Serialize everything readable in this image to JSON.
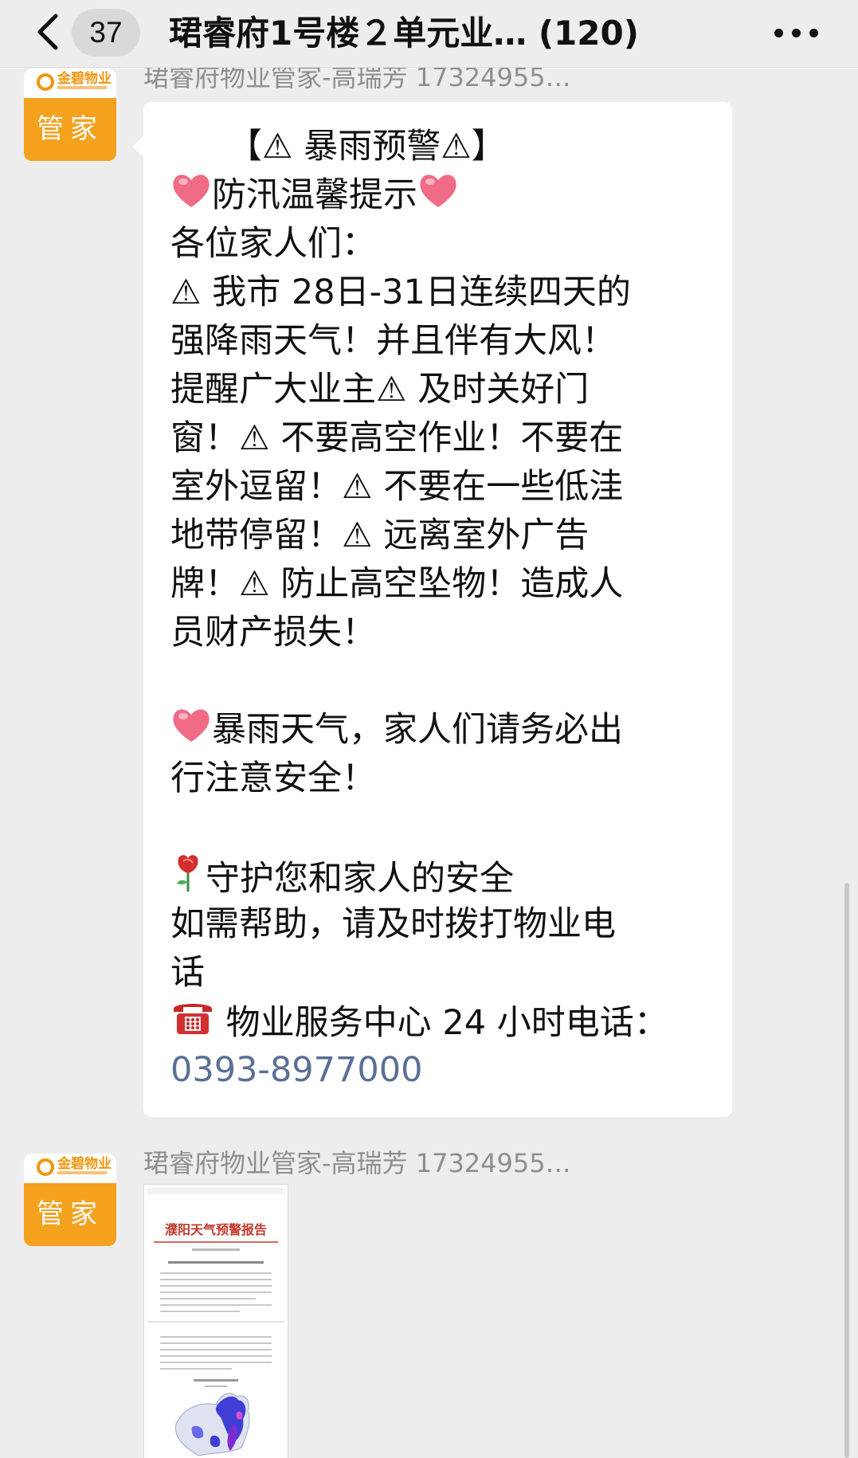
{
  "header": {
    "unread_count": "37",
    "title": "珺睿府1号楼２单元业…  (120)"
  },
  "messages": [
    {
      "sender": "珺睿府物业管家-高瑞芳 17324955…",
      "avatar": {
        "logo_text": "金碧物业",
        "main_text": "管家"
      },
      "lines": [
        "【⚠ 暴雨预警⚠】",
        "防汛温馨提示",
        "各位家人们：",
        "⚠ 我市 28日-31日连续四天的",
        "强降雨天气！并且伴有大风！",
        "提醒广大业主⚠ 及时关好门",
        "窗！⚠ 不要高空作业！不要在",
        "室外逗留！⚠ 不要在一些低洼",
        "地带停留！⚠ 远离室外广告",
        "牌！⚠ 防止高空坠物！造成人",
        "员财产损失！",
        "",
        "暴雨天气，家人们请务必出",
        "行注意安全！",
        "",
        "守护您和家人的安全",
        "如需帮助，请及时拨打物业电",
        "话",
        "物业服务中心 24 小时电话：",
        "0393-8977000"
      ]
    },
    {
      "sender": "珺睿府物业管家-高瑞芳 17324955…",
      "avatar": {
        "logo_text": "金碧物业",
        "main_text": "管家"
      },
      "image": {
        "title_text": "濮阳天气预警报告"
      }
    }
  ],
  "colors": {
    "background": "#ededed",
    "bubble": "#ffffff",
    "link": "#5a6f94",
    "avatar": "#f4a11d"
  }
}
